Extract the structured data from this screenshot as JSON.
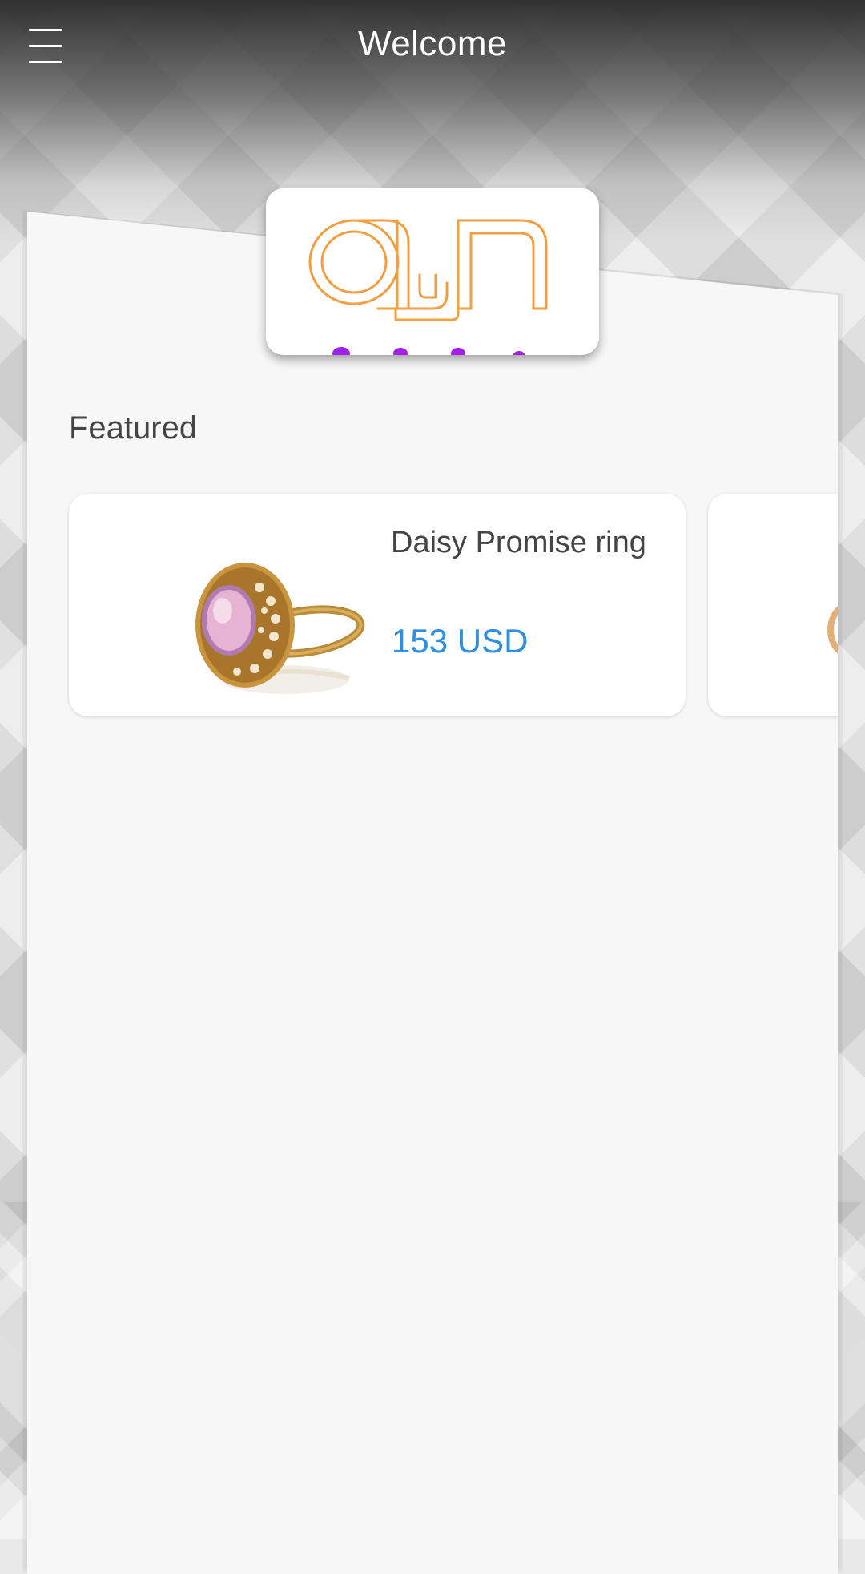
{
  "header": {
    "title": "Welcome",
    "menu_icon": "hamburger-menu-icon"
  },
  "logo": {
    "text": "ayn",
    "brand_color": "#F0A040",
    "accent_color": "#A020F0"
  },
  "featured": {
    "label": "Featured",
    "products": [
      {
        "name": "Daisy Promise ring",
        "price": "153 USD",
        "image": "gold-ring-pink-stone"
      },
      {
        "name": "",
        "price": "",
        "image": "ring-partial"
      }
    ]
  },
  "colors": {
    "price": "#2F8FE0",
    "text": "#444444",
    "panel": "#F7F7F7"
  }
}
